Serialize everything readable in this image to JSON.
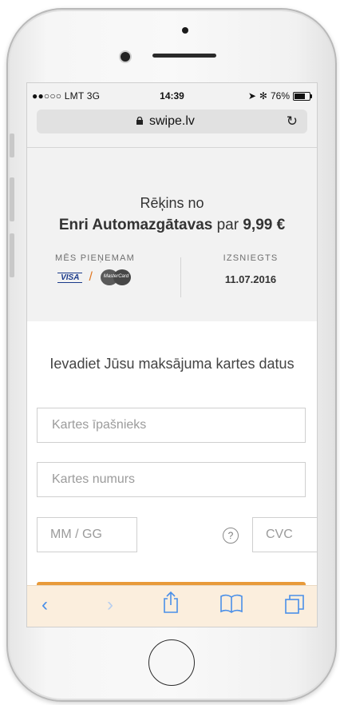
{
  "status": {
    "signal": "●●○○○ LMT  3G",
    "time": "14:39",
    "battery": "76%"
  },
  "browser": {
    "host": "swipe.lv"
  },
  "invoice": {
    "line1": "Rēķins no",
    "merchant": "Enri Automazgātavas",
    "par": "par",
    "amount": "9,99 €",
    "accept_label": "MĒS PIEŅEMAM",
    "visa": "VISA",
    "mastercard": "MasterCard",
    "issued_label": "IZSNIEGTS",
    "issued_date": "11.07.2016"
  },
  "form": {
    "title": "Ievadiet Jūsu maksājuma kartes datus",
    "holder_placeholder": "Kartes īpašnieks",
    "number_placeholder": "Kartes numurs",
    "expiry_placeholder": "MM / GG",
    "cvc_placeholder": "CVC",
    "help": "?"
  },
  "toolbar": {
    "back": "‹",
    "forward": "›",
    "share": "⇧",
    "bookmarks": "📖",
    "tabs": "❐"
  },
  "colors": {
    "accent_blue": "#4a8fe8",
    "toolbar_bg": "#fbeedd",
    "orange": "#e89a3a"
  }
}
